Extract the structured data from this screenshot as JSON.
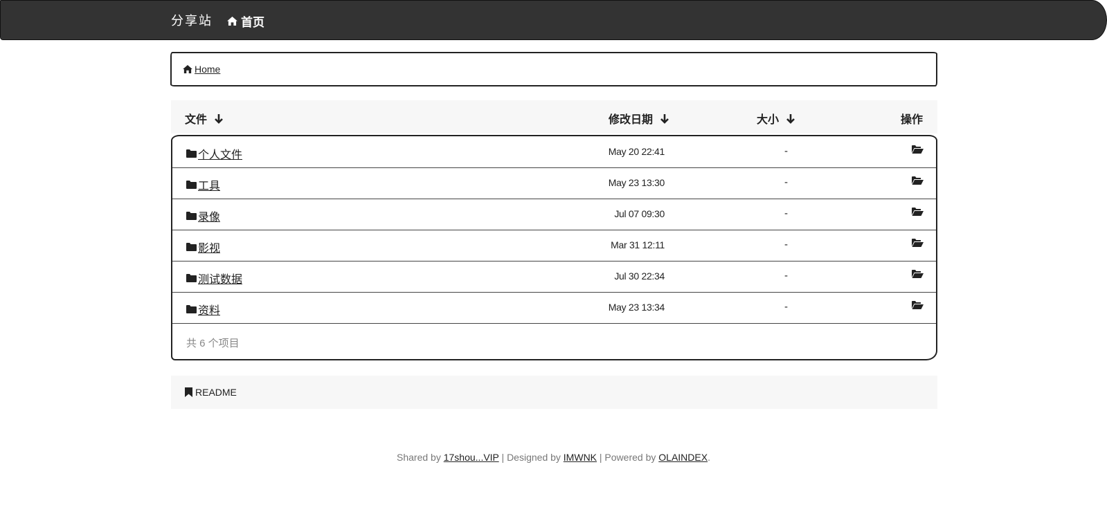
{
  "navbar": {
    "brand": "分享站",
    "home_label": "首页"
  },
  "breadcrumb": {
    "home_label": "Home"
  },
  "table": {
    "headers": {
      "file": "文件",
      "date": "修改日期",
      "size": "大小",
      "ops": "操作"
    },
    "rows": [
      {
        "name": "个人文件",
        "date": "May 20 22:41",
        "size": "-"
      },
      {
        "name": "工具",
        "date": "May 23 13:30",
        "size": "-"
      },
      {
        "name": "录像",
        "date": "Jul 07 09:30",
        "size": "-"
      },
      {
        "name": "影视",
        "date": "Mar 31 12:11",
        "size": "-"
      },
      {
        "name": "测试数据",
        "date": "Jul 30 22:34",
        "size": "-"
      },
      {
        "name": "资料",
        "date": "May 23 13:34",
        "size": "-"
      }
    ],
    "total": "共 6 个项目"
  },
  "readme": {
    "label": "README"
  },
  "footer": {
    "shared_prefix": "Shared by ",
    "shared_link": "17shou...VIP",
    "designed_prefix": " | Designed by ",
    "designed_link": "IMWNK",
    "powered_prefix": " | Powered by ",
    "powered_link": "OLAINDEX",
    "end": "."
  }
}
